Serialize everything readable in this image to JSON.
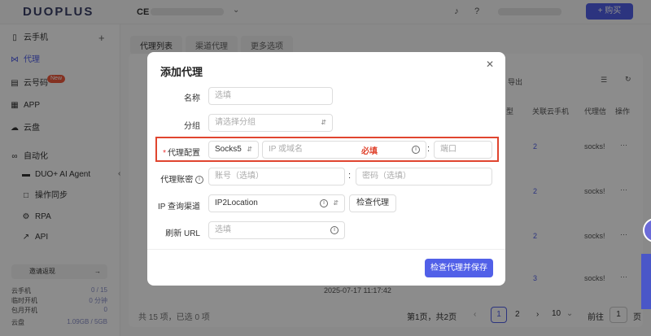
{
  "topbar": {
    "logo": "DUOPLUS",
    "workspace": "CE",
    "buy_label": "+ 购买",
    "colors": {
      "primary": "#5160e8",
      "danger": "#e0452f"
    }
  },
  "sidebar": {
    "items": [
      {
        "label": "云手机",
        "icon": "phone-icon"
      },
      {
        "label": "代理",
        "icon": "proxy-icon"
      },
      {
        "label": "云号码",
        "icon": "number-icon",
        "badge": "New"
      },
      {
        "label": "APP",
        "icon": "grid-icon"
      },
      {
        "label": "云盘",
        "icon": "cloud-icon"
      },
      {
        "label": "自动化",
        "icon": "infinity-icon"
      },
      {
        "label": "DUO+ AI Agent",
        "icon": "ai-icon"
      },
      {
        "label": "操作同步",
        "icon": "sync-icon"
      },
      {
        "label": "RPA",
        "icon": "rpa-icon"
      },
      {
        "label": "API",
        "icon": "api-icon"
      }
    ],
    "invite": "邀请返现",
    "stats": [
      {
        "label": "云手机",
        "value": "0 / 15"
      },
      {
        "label": "临时开机",
        "value": "0 分钟"
      },
      {
        "label": "包月开机",
        "value": "0"
      },
      {
        "label": "云盘",
        "value": "1.09GB / 5GB"
      }
    ]
  },
  "content": {
    "tabs": [
      "代理列表",
      "渠道代理",
      "更多选项"
    ],
    "export_label": "导出",
    "col_bound_phones": "关联云手机",
    "col_proxy_info": "代理信",
    "col_actions": "操作",
    "col_type": "型",
    "row_values": [
      "2",
      "2",
      "2",
      "3"
    ],
    "row_protocol": "socks!",
    "timestamp": "2025-07-17 11:17:42",
    "summary": "共 15 项，已选 0 项",
    "pager": {
      "info": "第1页，共2页",
      "pages": [
        "1",
        "2"
      ],
      "page_size": "10",
      "goto_label": "前往",
      "goto_value": "1",
      "page_unit": "页"
    }
  },
  "modal": {
    "title": "添加代理",
    "fields": {
      "name": {
        "label": "名称",
        "placeholder": "选填"
      },
      "group": {
        "label": "分组",
        "placeholder": "请选择分组"
      },
      "proxy_config": {
        "label": "代理配置",
        "protocol": "Socks5",
        "host_placeholder": "IP 或域名",
        "required_note": "必填",
        "port_placeholder": "端口"
      },
      "account": {
        "label": "代理账密",
        "user_placeholder": "账号（选填）",
        "pass_placeholder": "密码（选填）"
      },
      "ip_channel": {
        "label": "IP 查询渠道",
        "value": "IP2Location",
        "check_label": "检查代理"
      },
      "refresh_url": {
        "label": "刷新 URL",
        "placeholder": "选填"
      }
    },
    "save_label": "检查代理并保存"
  }
}
